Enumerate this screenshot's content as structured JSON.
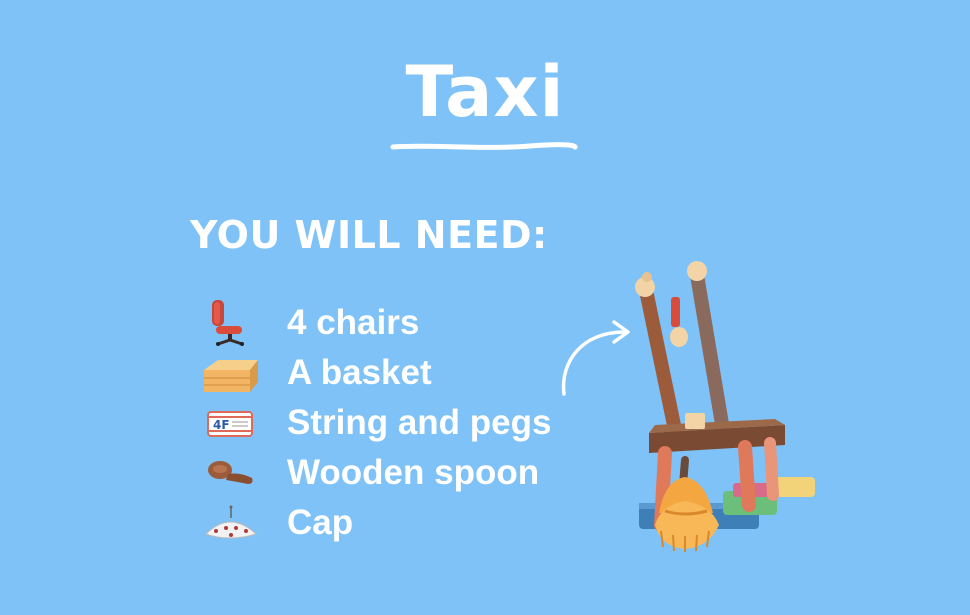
{
  "title": "Taxi",
  "subtitle": "You will need:",
  "items": [
    {
      "label": "4 chairs",
      "icon": "office-chair-icon"
    },
    {
      "label": "A basket",
      "icon": "basket-icon"
    },
    {
      "label": "String and pegs",
      "icon": "pegs-card-icon"
    },
    {
      "label": "Wooden spoon",
      "icon": "wooden-spoon-icon"
    },
    {
      "label": "Cap",
      "icon": "umbrella-cap-icon"
    }
  ],
  "colors": {
    "background": "#7fc2f7",
    "text": "#ffffff",
    "wood": "#9c5b3b",
    "broom": "#f4a640",
    "chair_red": "#d94b3b"
  }
}
